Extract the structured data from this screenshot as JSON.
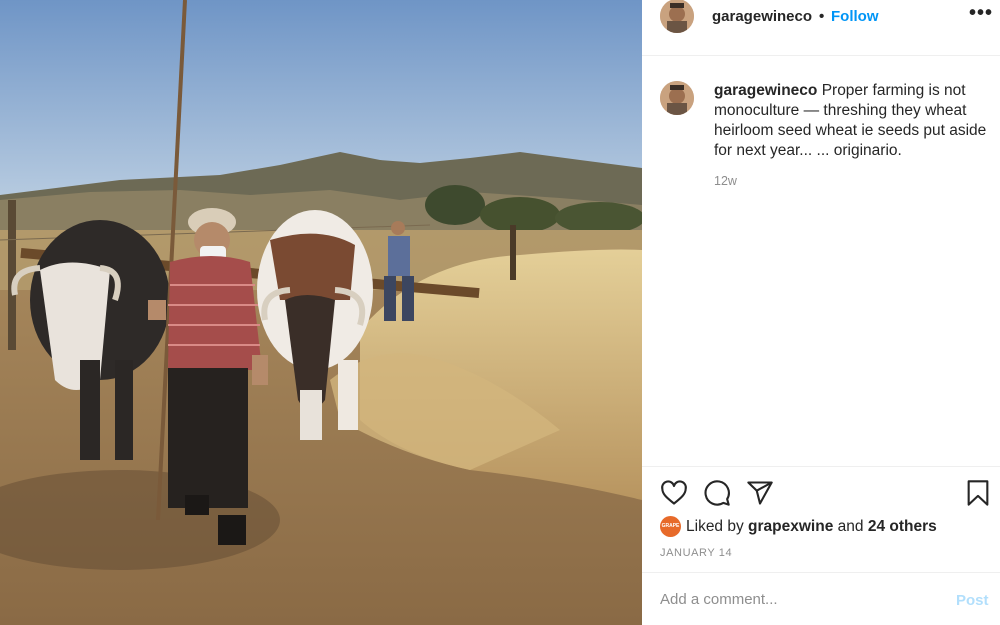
{
  "post": {
    "username": "garagewineco",
    "follow_label": "Follow",
    "separator": "•",
    "more_label": "•••"
  },
  "caption": {
    "username": "garagewineco",
    "text": "Proper farming is not monoculture — threshing they wheat heirloom seed wheat ie seeds put aside for next year... ... originario.",
    "age": "12w"
  },
  "actions": {
    "icons": [
      "heart-icon",
      "comment-icon",
      "share-icon",
      "bookmark-icon"
    ]
  },
  "likes": {
    "prefix": "Liked by",
    "user": "grapexwine",
    "middle": "and",
    "others": "24 others",
    "liker_avatar_text": "GRAPE"
  },
  "date": "JANUARY 14",
  "comment": {
    "placeholder": "Add a comment...",
    "post_label": "Post"
  },
  "colors": {
    "follow": "#0095f6",
    "post_disabled": "#b2dffc",
    "muted": "#8e8e8e",
    "liker_avatar": "#e76a2a"
  }
}
